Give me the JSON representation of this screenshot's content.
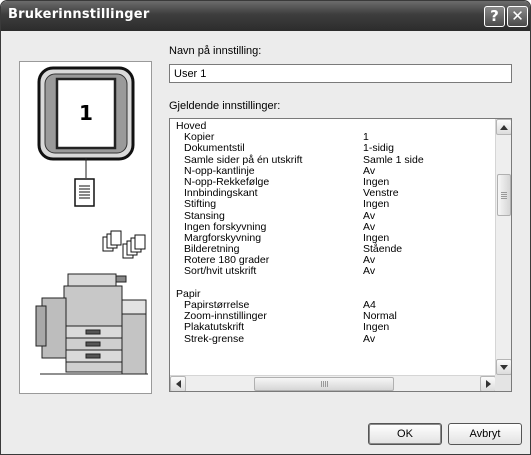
{
  "window": {
    "title": "Brukerinnstillinger",
    "help_glyph": "?",
    "close_glyph": "✕"
  },
  "preview": {
    "page_number": "1"
  },
  "name_field": {
    "label": "Navn på innstilling:",
    "value": "User 1"
  },
  "settings": {
    "label": "Gjeldende innstillinger:",
    "groups": [
      {
        "heading": "Hoved",
        "items": [
          {
            "key": "Kopier",
            "value": "1"
          },
          {
            "key": "Dokumentstil",
            "value": "1-sidig"
          },
          {
            "key": "Samle sider på én utskrift",
            "value": "Samle 1 side"
          },
          {
            "key": "N-opp-kantlinje",
            "value": "Av"
          },
          {
            "key": "N-opp-Rekkefølge",
            "value": "Ingen"
          },
          {
            "key": "Innbindingskant",
            "value": "Venstre"
          },
          {
            "key": "Stifting",
            "value": "Ingen"
          },
          {
            "key": "Stansing",
            "value": "Av"
          },
          {
            "key": "Ingen forskyvning",
            "value": "Av"
          },
          {
            "key": "Margforskyvning",
            "value": "Ingen"
          },
          {
            "key": "Bilderetning",
            "value": "Stående"
          },
          {
            "key": "Rotere 180 grader",
            "value": "Av"
          },
          {
            "key": "Sort/hvit utskrift",
            "value": "Av"
          }
        ]
      },
      {
        "heading": "Papir",
        "items": [
          {
            "key": "Papirstørrelse",
            "value": "A4"
          },
          {
            "key": "Zoom-innstillinger",
            "value": "Normal"
          },
          {
            "key": "Plakatutskrift",
            "value": "Ingen"
          },
          {
            "key": "Strek-grense",
            "value": "Av"
          }
        ]
      }
    ]
  },
  "buttons": {
    "ok": "OK",
    "cancel": "Avbryt"
  },
  "icons": [
    "help-icon",
    "close-icon",
    "document-icon",
    "copies-icon",
    "printer-icon",
    "scroll-up-arrow-icon",
    "scroll-down-arrow-icon",
    "scroll-left-arrow-icon",
    "scroll-right-arrow-icon"
  ]
}
